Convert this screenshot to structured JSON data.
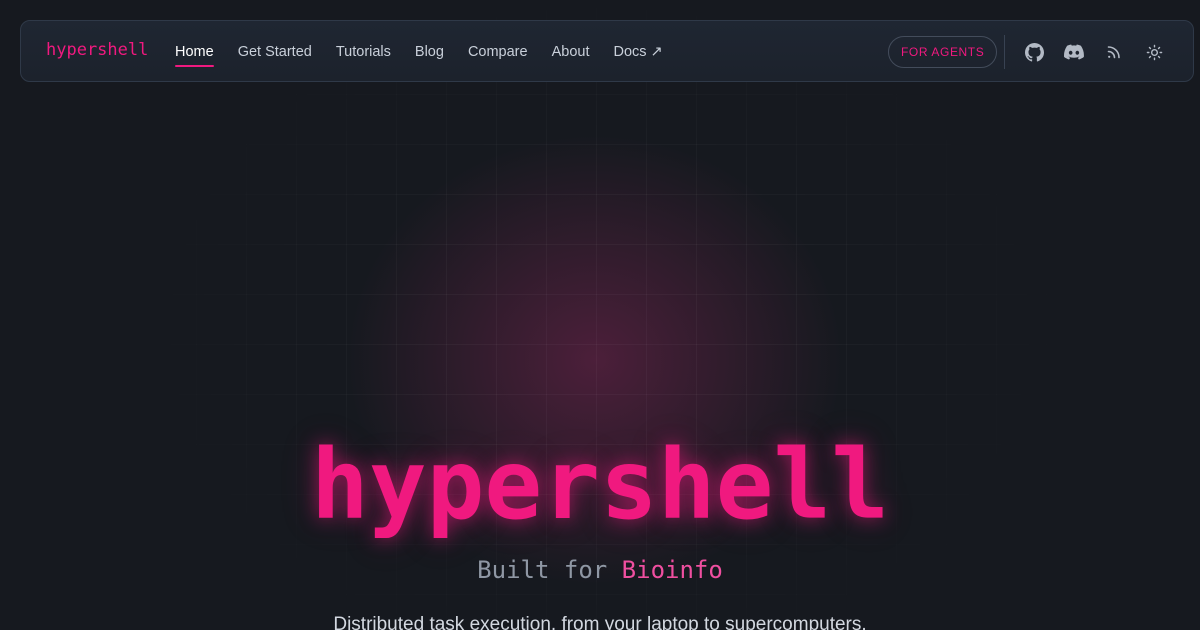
{
  "navbar": {
    "brand": "hypershell",
    "links": [
      {
        "label": "Home",
        "active": true
      },
      {
        "label": "Get Started",
        "active": false
      },
      {
        "label": "Tutorials",
        "active": false
      },
      {
        "label": "Blog",
        "active": false
      },
      {
        "label": "Compare",
        "active": false
      },
      {
        "label": "About",
        "active": false
      },
      {
        "label": "Docs ↗",
        "active": false
      }
    ],
    "agents_button": "FOR AGENTS",
    "icons": [
      "github-icon",
      "discord-icon",
      "rss-icon",
      "theme-toggle-sun-icon"
    ]
  },
  "hero": {
    "title": "hypershell",
    "subtitle_prefix": "Built for ",
    "subtitle_accent": "Bioinfo",
    "description": "Distributed task execution, from your laptop to supercomputers."
  },
  "colors": {
    "accent": "#f0197f",
    "background": "#16191f",
    "nav_background": "#1f2632",
    "nav_text": "#c9d0da",
    "muted_text": "#8f97a4"
  }
}
